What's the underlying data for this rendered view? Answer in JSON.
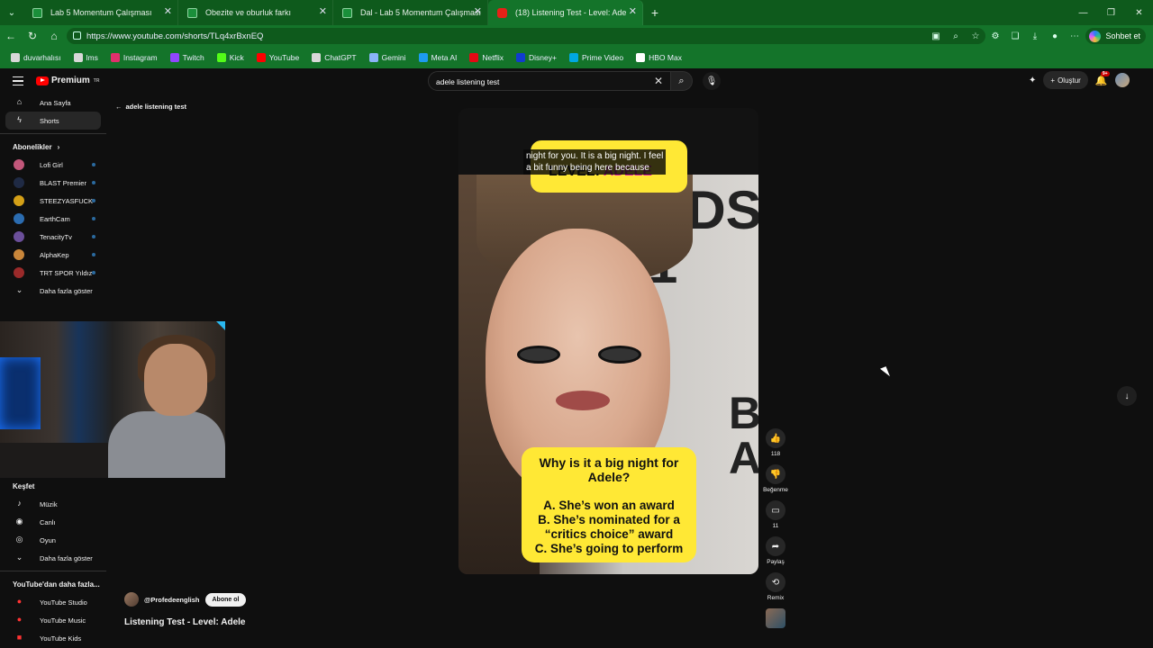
{
  "browser": {
    "tabs": [
      {
        "label": "Lab 5 Momentum Çalışması",
        "icon": "doc-icon"
      },
      {
        "label": "Obezite ve oburluk farkı",
        "icon": "doc-icon"
      },
      {
        "label": "Dal - Lab 5 Momentum Çalışması",
        "icon": "doc-icon"
      },
      {
        "label": "(18) Listening Test - Level: Ade",
        "icon": "youtube-icon"
      }
    ],
    "url": "https://www.youtube.com/shorts/TLq4xrBxnEQ",
    "chat_label": "Sohbet et",
    "bookmarks": [
      {
        "label": "duvarhalısı",
        "color": "#d8d8d8"
      },
      {
        "label": "lms",
        "color": "#d8d8d8"
      },
      {
        "label": "Instagram",
        "color": "#e1306c"
      },
      {
        "label": "Twitch",
        "color": "#9146ff"
      },
      {
        "label": "Kick",
        "color": "#53fc18"
      },
      {
        "label": "YouTube",
        "color": "#ff0000"
      },
      {
        "label": "ChatGPT",
        "color": "#d8d8d8"
      },
      {
        "label": "Gemini",
        "color": "#8ab4f8"
      },
      {
        "label": "Meta AI",
        "color": "#1d9bf0"
      },
      {
        "label": "Netflix",
        "color": "#e50914"
      },
      {
        "label": "Disney+",
        "color": "#113ccf"
      },
      {
        "label": "Prime Video",
        "color": "#00a8e1"
      },
      {
        "label": "HBO Max",
        "color": "#ffffff"
      }
    ]
  },
  "youtube": {
    "logo": "Premium",
    "logo_sup": "TR",
    "search_value": "adele listening test",
    "create_label": "Oluştur",
    "notif_count": "9+",
    "back_label": "adele listening test",
    "sidebar": {
      "main": [
        {
          "label": "Ana Sayfa",
          "icon": "home-icon"
        },
        {
          "label": "Shorts",
          "icon": "shorts-icon"
        }
      ],
      "subs_header": "Abonelikler",
      "subs": [
        {
          "label": "Lofi Girl",
          "color": "#c2577a"
        },
        {
          "label": "BLAST Premier",
          "color": "#1f2a44"
        },
        {
          "label": "STEEZYASFUCK",
          "color": "#d4a017"
        },
        {
          "label": "EarthCam",
          "color": "#2b6cb0"
        },
        {
          "label": "TenacityTv",
          "color": "#6b4f9a"
        },
        {
          "label": "AlphaKep",
          "color": "#c9863a"
        },
        {
          "label": "TRT SPOR Yıldız",
          "color": "#9a2a2a"
        }
      ],
      "more_label": "Daha fazla göster",
      "explore_header": "Keşfet",
      "explore": [
        {
          "label": "Müzik",
          "icon": "music-icon"
        },
        {
          "label": "Canlı",
          "icon": "live-icon"
        },
        {
          "label": "Oyun",
          "icon": "gaming-icon"
        }
      ],
      "explore_more": "Daha fazla göster",
      "more_yt_header": "YouTube'dan daha fazla...",
      "more_yt": [
        {
          "label": "YouTube Studio"
        },
        {
          "label": "YouTube Music"
        },
        {
          "label": "YouTube Kids"
        }
      ]
    },
    "short": {
      "caption_line1": "night for you. It is a big night. I feel",
      "caption_line2": "a bit funny being here because",
      "level_text": "LEVEL: ",
      "level_name": "ADELE",
      "question": "Why is it a big night for Adele?",
      "options": [
        "A. She’s won an award",
        "B. She’s nominated for a",
        "“critics choice” award",
        "C. She’s going to perform"
      ],
      "like_count": "118",
      "dislike_label": "Beğenme",
      "comment_count": "11",
      "share_label": "Paylaş",
      "remix_label": "Remix",
      "channel": "@Profedeenglish",
      "subscribe_label": "Abone ol",
      "title": "Listening Test - Level: Adele"
    }
  }
}
